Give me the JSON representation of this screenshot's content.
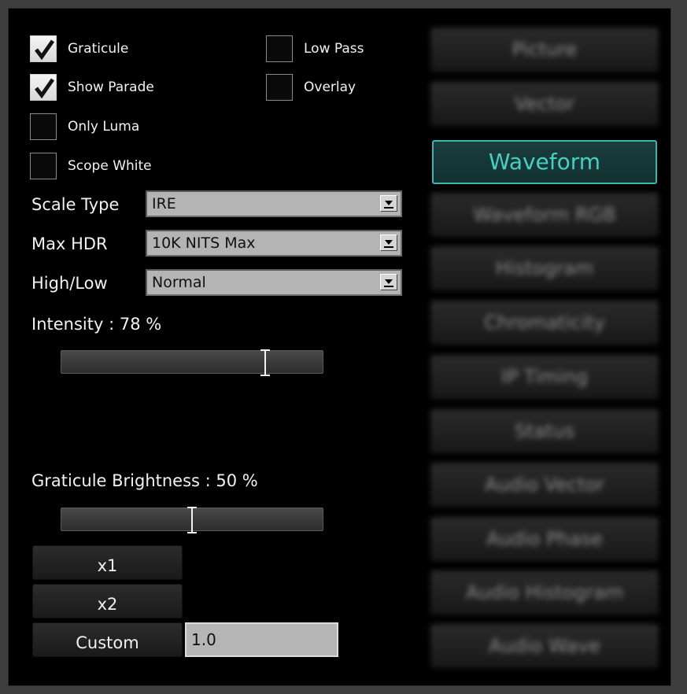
{
  "checkboxes": [
    {
      "label": "Graticule",
      "checked": true
    },
    {
      "label": "Show Parade",
      "checked": true
    },
    {
      "label": "Only Luma",
      "checked": false
    },
    {
      "label": "Scope White",
      "checked": false
    },
    {
      "label": "Low Pass",
      "checked": false
    },
    {
      "label": "Overlay",
      "checked": false
    }
  ],
  "settings": {
    "scale_type": {
      "label": "Scale Type",
      "value": "IRE"
    },
    "max_hdr": {
      "label": "Max HDR",
      "value": "10K NITS Max"
    },
    "high_low": {
      "label": "High/Low",
      "value": "Normal"
    }
  },
  "intensity": {
    "label": "Intensity : 78 %",
    "value": 78
  },
  "graticule_brightness": {
    "label": "Graticule Brightness : 50 %",
    "value": 50
  },
  "zoom": {
    "x1": "x1",
    "x2": "x2",
    "custom": "Custom",
    "custom_value": "1.0"
  },
  "scopes": [
    "Picture",
    "Vector",
    "Waveform",
    "Waveform RGB",
    "Histogram",
    "Chromaticity",
    "IP Timing",
    "Status",
    "Audio Vector",
    "Audio Phase",
    "Audio Histogram",
    "Audio Wave"
  ],
  "active_scope": "Waveform",
  "colors": {
    "accent": "#46d0c4",
    "panel": "#000000",
    "frame": "#3e3e3e"
  }
}
